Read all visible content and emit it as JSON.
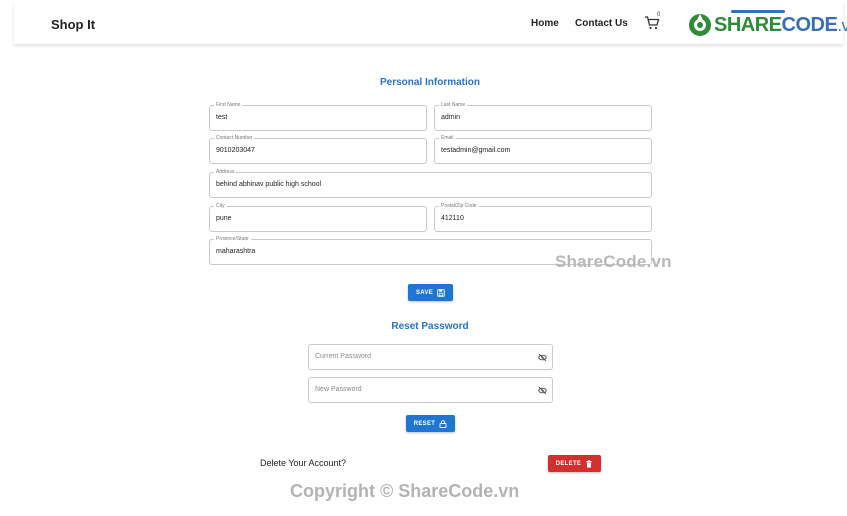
{
  "header": {
    "brand": "Shop It",
    "nav": {
      "home": "Home",
      "contact": "Contact Us"
    },
    "cart_icon": "cart-icon",
    "cart_badge": "0",
    "logo": {
      "share": "SHARE",
      "code": "CODE",
      "vn": ".vn"
    }
  },
  "personal": {
    "title": "Personal Information",
    "fields": {
      "first_name": {
        "label": "First Name",
        "value": "test"
      },
      "last_name": {
        "label": "Last Name",
        "value": "admin"
      },
      "contact": {
        "label": "Contact Number",
        "value": "9010203047"
      },
      "email": {
        "label": "Email",
        "value": "testadmin@gmail.com"
      },
      "address": {
        "label": "Address",
        "value": "behind abhinav public high school"
      },
      "city": {
        "label": "City",
        "value": "pune"
      },
      "postal": {
        "label": "Postal/Zip Code",
        "value": "412110"
      },
      "province": {
        "label": "Province/State",
        "value": "maharashtra"
      }
    },
    "save_label": "SAVE",
    "save_icon": "save-icon"
  },
  "reset": {
    "title": "Reset Password",
    "current_placeholder": "Current Password",
    "new_placeholder": "New Password",
    "eye_icon": "eye-off-icon",
    "reset_label": "RESET",
    "reset_icon": "lock-icon"
  },
  "delete": {
    "prompt": "Delete Your Account?",
    "button_label": "DELETE",
    "button_icon": "trash-icon"
  },
  "watermarks": {
    "mid": "ShareCode.vn",
    "bottom": "Copyright © ShareCode.vn"
  },
  "colors": {
    "primary": "#1f76d2",
    "danger": "#d32f2f",
    "heading": "#2a73c5",
    "logo_green": "#2e8b3a",
    "logo_blue": "#3a6fb7"
  }
}
